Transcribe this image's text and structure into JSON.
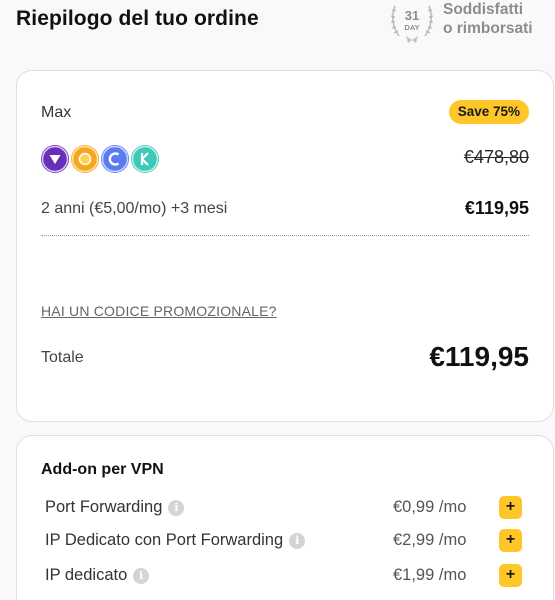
{
  "header": {
    "title": "Riepilogo del tuo ordine",
    "guarantee_line1": "Soddisfatti",
    "guarantee_line2": "o rimborsati",
    "seal_number": "31",
    "seal_unit": "DAY"
  },
  "summary": {
    "plan_name": "Max",
    "save_badge": "Save 75%",
    "app_icons": [
      "vpn-icon",
      "password-manager-icon",
      "cloud-icon",
      "file-encryption-icon"
    ],
    "icon_colors": [
      "#6a2fb8",
      "#f5a623",
      "#5a7cf0",
      "#3ec8b8"
    ],
    "original_price": "€478,80",
    "term": "2 anni (€5,00/mo) +3 mesi",
    "term_price": "€119,95",
    "promo_link": "HAI UN CODICE PROMOZIONALE?",
    "total_label": "Totale",
    "total_price": "€119,95"
  },
  "addons": {
    "title": "Add-on per VPN",
    "items": [
      {
        "name": "Port Forwarding",
        "price": "€0,99 /mo",
        "add": "+"
      },
      {
        "name": "IP Dedicato con Port Forwarding",
        "price": "€2,99 /mo",
        "add": "+"
      },
      {
        "name": "IP dedicato",
        "price": "€1,99 /mo",
        "add": "+"
      }
    ]
  },
  "colors": {
    "accent": "#ffc629",
    "background": "#fbf8fc"
  }
}
